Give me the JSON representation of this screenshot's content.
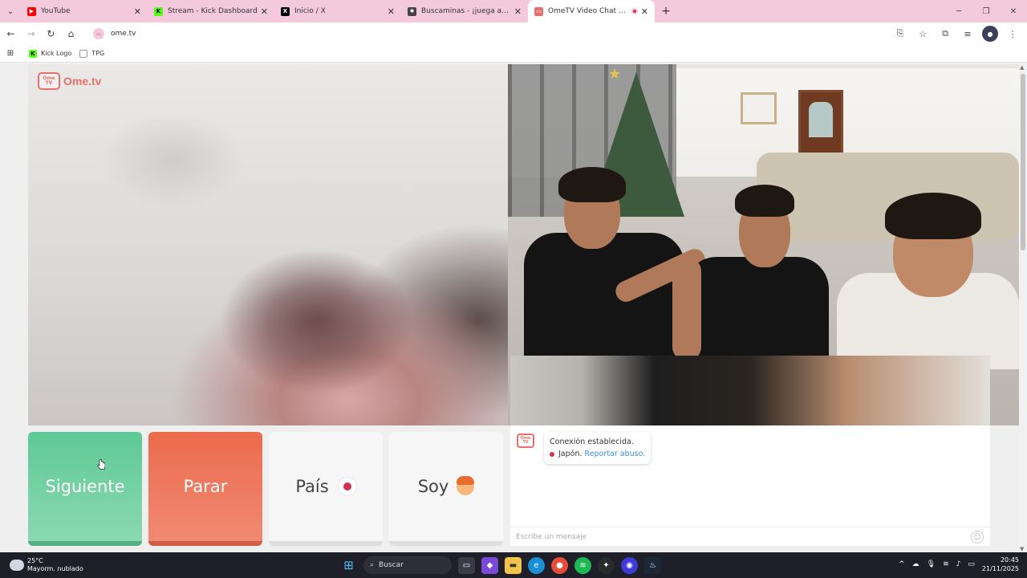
{
  "browser": {
    "tabs": [
      {
        "title": "YouTube",
        "icon": "youtube-icon",
        "color": "#ff0000",
        "active": false
      },
      {
        "title": "Stream - Kick Dashboard",
        "icon": "kick-icon",
        "color": "#53fc18",
        "active": false
      },
      {
        "title": "Inicio / X",
        "icon": "x-icon",
        "color": "#000000",
        "active": false
      },
      {
        "title": "Buscaminas - ¡juega ahora!",
        "icon": "minesweeper-icon",
        "color": "#333333",
        "active": false
      },
      {
        "title": "OmeTV Video Chat — Ome",
        "icon": "ometv-icon",
        "color": "#e9706a",
        "active": true
      }
    ],
    "url": "ome.tv",
    "bookmarks": [
      {
        "label": "Kick Logo",
        "icon": "kick-icon"
      },
      {
        "label": "TPG",
        "icon": "tpg-icon"
      }
    ]
  },
  "page": {
    "logo_text": "Ome.tv",
    "logo_badge": "Ome TV",
    "buttons": {
      "next": "Siguiente",
      "stop": "Parar",
      "country": "País",
      "gender": "Soy"
    },
    "chat": {
      "status": "Conexión establecida.",
      "country": "Japón.",
      "report_link": "Reportar abuso.",
      "input_placeholder": "Escribe un mensaje",
      "country_flag_color": "#d5304f"
    },
    "colors": {
      "next": "#5ec996",
      "stop": "#ec6a4d",
      "brand": "#e9706a"
    }
  },
  "taskbar": {
    "weather_temp": "25°C",
    "weather_desc": "Mayorm. nublado",
    "search_label": "Buscar",
    "time": "20:45",
    "date": "21/11/2025"
  }
}
